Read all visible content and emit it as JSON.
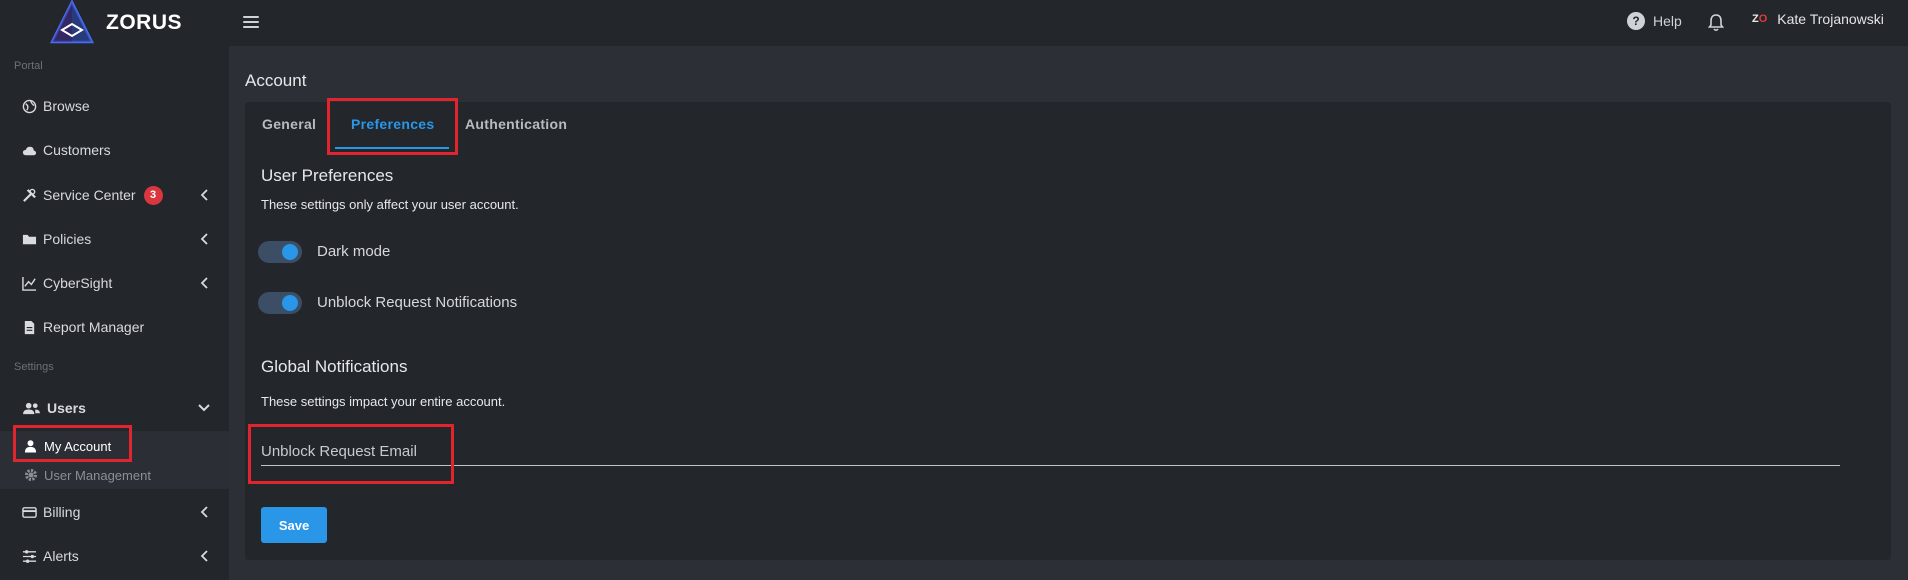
{
  "brand": {
    "name": "ZORUS"
  },
  "topbar": {
    "help_label": "Help",
    "user_initials_a": "Z",
    "user_initials_b": "O",
    "user_name": "Kate Trojanowski"
  },
  "sidebar": {
    "portal_label": "Portal",
    "settings_label": "Settings",
    "items": [
      {
        "label": "Browse",
        "icon": "globe-icon"
      },
      {
        "label": "Customers",
        "icon": "cloud-icon"
      },
      {
        "label": "Service Center",
        "icon": "tools-icon",
        "badge": "3"
      },
      {
        "label": "Policies",
        "icon": "folder-icon"
      },
      {
        "label": "CyberSight",
        "icon": "chart-line-icon"
      },
      {
        "label": "Report Manager",
        "icon": "document-icon"
      }
    ],
    "users_label": "Users",
    "my_account_label": "My Account",
    "user_management_label": "User Management",
    "billing_label": "Billing",
    "alerts_label": "Alerts"
  },
  "page": {
    "title": "Account",
    "tabs": [
      "General",
      "Preferences",
      "Authentication"
    ],
    "active_tab": "Preferences",
    "user_prefs_title": "User Preferences",
    "user_prefs_desc": "These settings only affect your user account.",
    "dark_mode_label": "Dark mode",
    "unblock_notif_label": "Unblock Request Notifications",
    "global_title": "Global Notifications",
    "global_desc": "These settings impact your entire account.",
    "email_placeholder": "Unblock Request Email",
    "save_label": "Save"
  },
  "colors": {
    "accent": "#2a96e8",
    "highlight": "#e1252f",
    "badge": "#d9363e"
  }
}
